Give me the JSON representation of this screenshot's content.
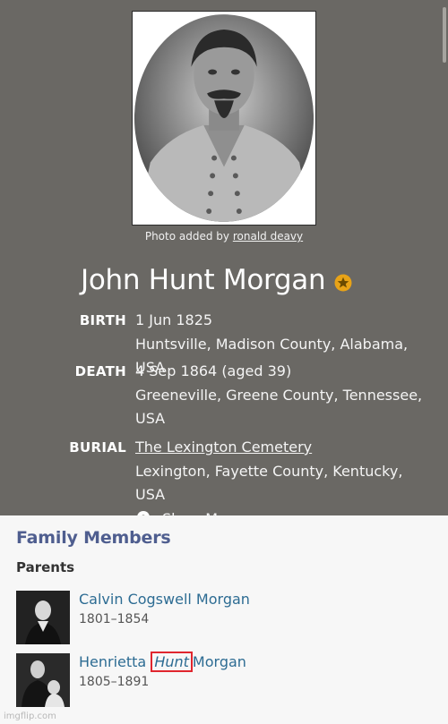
{
  "memorial": {
    "photo_credit_prefix": "Photo added by",
    "photo_credit_user": "ronald deavy",
    "name": "John Hunt Morgan",
    "badge_icon": "star-badge-icon",
    "accent_color": "#e8a317",
    "birth": {
      "label": "BIRTH",
      "date": "1 Jun 1825",
      "place": "Huntsville, Madison County, Alabama, USA"
    },
    "death": {
      "label": "DEATH",
      "date": "4 Sep 1864 (aged 39)",
      "place_line1": "Greeneville, Greene County, Tennessee,",
      "place_line2": "USA"
    },
    "burial": {
      "label": "BURIAL",
      "cemetery": "The Lexington Cemetery",
      "place": "Lexington, Fayette County, Kentucky, USA",
      "show_map": "Show Map"
    }
  },
  "family": {
    "title": "Family Members",
    "parents_label": "Parents",
    "parents": [
      {
        "name": "Calvin Cogswell Morgan",
        "dates": "1801–1854"
      },
      {
        "name_before": "Henrietta",
        "name_highlight": "Hunt",
        "name_after": "Morgan",
        "dates": "1805–1891"
      }
    ]
  },
  "watermark": "imgflip.com"
}
